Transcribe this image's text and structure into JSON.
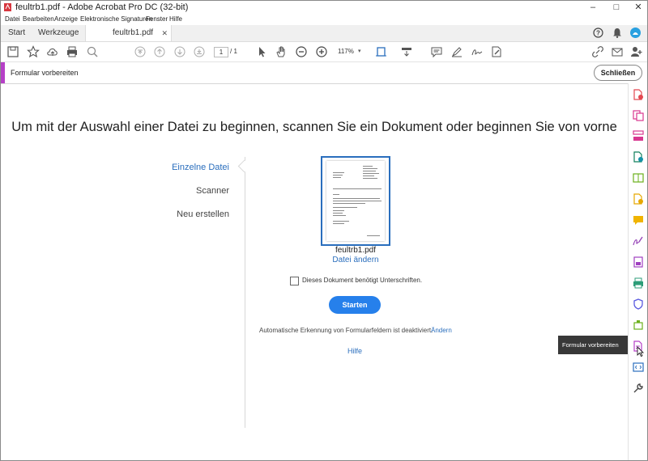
{
  "window": {
    "title": "feultrb1.pdf - Adobe Acrobat Pro DC (32-bit)"
  },
  "menu": [
    "Datei",
    "Bearbeiten",
    "Anzeige",
    "Elektronische Signaturen",
    "Fenster",
    "Hilfe"
  ],
  "tabs": {
    "start": "Start",
    "tools": "Werkzeuge",
    "document": "feultrb1.pdf"
  },
  "toolbar": {
    "page_current": "1",
    "page_total": "/ 1",
    "zoom": "117%"
  },
  "tool_header": {
    "name": "Formular vorbereiten",
    "close_label": "Schließen"
  },
  "main": {
    "headline": "Um mit der Auswahl einer Datei zu beginnen, scannen Sie ein Dokument oder beginnen Sie von vorne",
    "nav": [
      "Einzelne Datei",
      "Scanner",
      "Neu erstellen"
    ],
    "file_name": "feultrb1.pdf",
    "change_file": "Datei ändern",
    "signature_checkbox_label": "Dieses Dokument benötigt Unterschriften.",
    "signature_checked": false,
    "start_button": "Starten",
    "auto_detect_text": "Automatische Erkennung von Formularfeldern ist deaktiviert.",
    "auto_detect_link": "Ändern",
    "help_link": "Hilfe"
  },
  "tooltip": "Formular vorbereiten",
  "colors": {
    "accent_purple": "#b640c7",
    "link_blue": "#2a6ebd",
    "button_blue": "#2680eb",
    "tooltip_bg": "#383838"
  }
}
